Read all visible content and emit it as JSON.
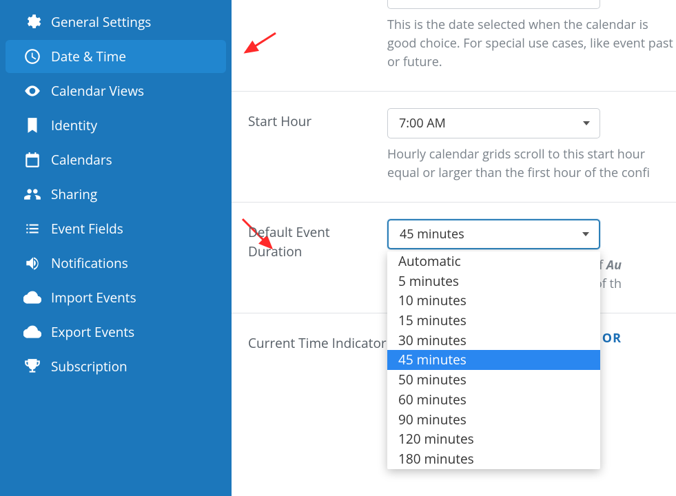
{
  "sidebar": {
    "items": [
      {
        "label": "General Settings"
      },
      {
        "label": "Date & Time"
      },
      {
        "label": "Calendar Views"
      },
      {
        "label": "Identity"
      },
      {
        "label": "Calendars"
      },
      {
        "label": "Sharing"
      },
      {
        "label": "Event Fields"
      },
      {
        "label": "Notifications"
      },
      {
        "label": "Import Events"
      },
      {
        "label": "Export Events"
      },
      {
        "label": "Subscription"
      }
    ]
  },
  "top_help": "This is the date selected when the calendar is good choice. For special use cases, like event past or future.",
  "start_hour": {
    "label": "Start Hour",
    "value": "7:00 AM",
    "help": "Hourly calendar grids scroll to this start hour equal or larger than the first hour of the confi"
  },
  "default_duration": {
    "label": "Default Event Duration",
    "value": "45 minutes",
    "options": [
      "Automatic",
      "5 minutes",
      "10 minutes",
      "15 minutes",
      "30 minutes",
      "45 minutes",
      "50 minutes",
      "60 minutes",
      "90 minutes",
      "120 minutes",
      "180 minutes"
    ],
    "help_fragments": {
      "a": "alue of ",
      "b": "Au",
      "c": "ution of th"
    }
  },
  "current_time": {
    "label": "Current Time Indicator"
  },
  "or_label": "OR"
}
